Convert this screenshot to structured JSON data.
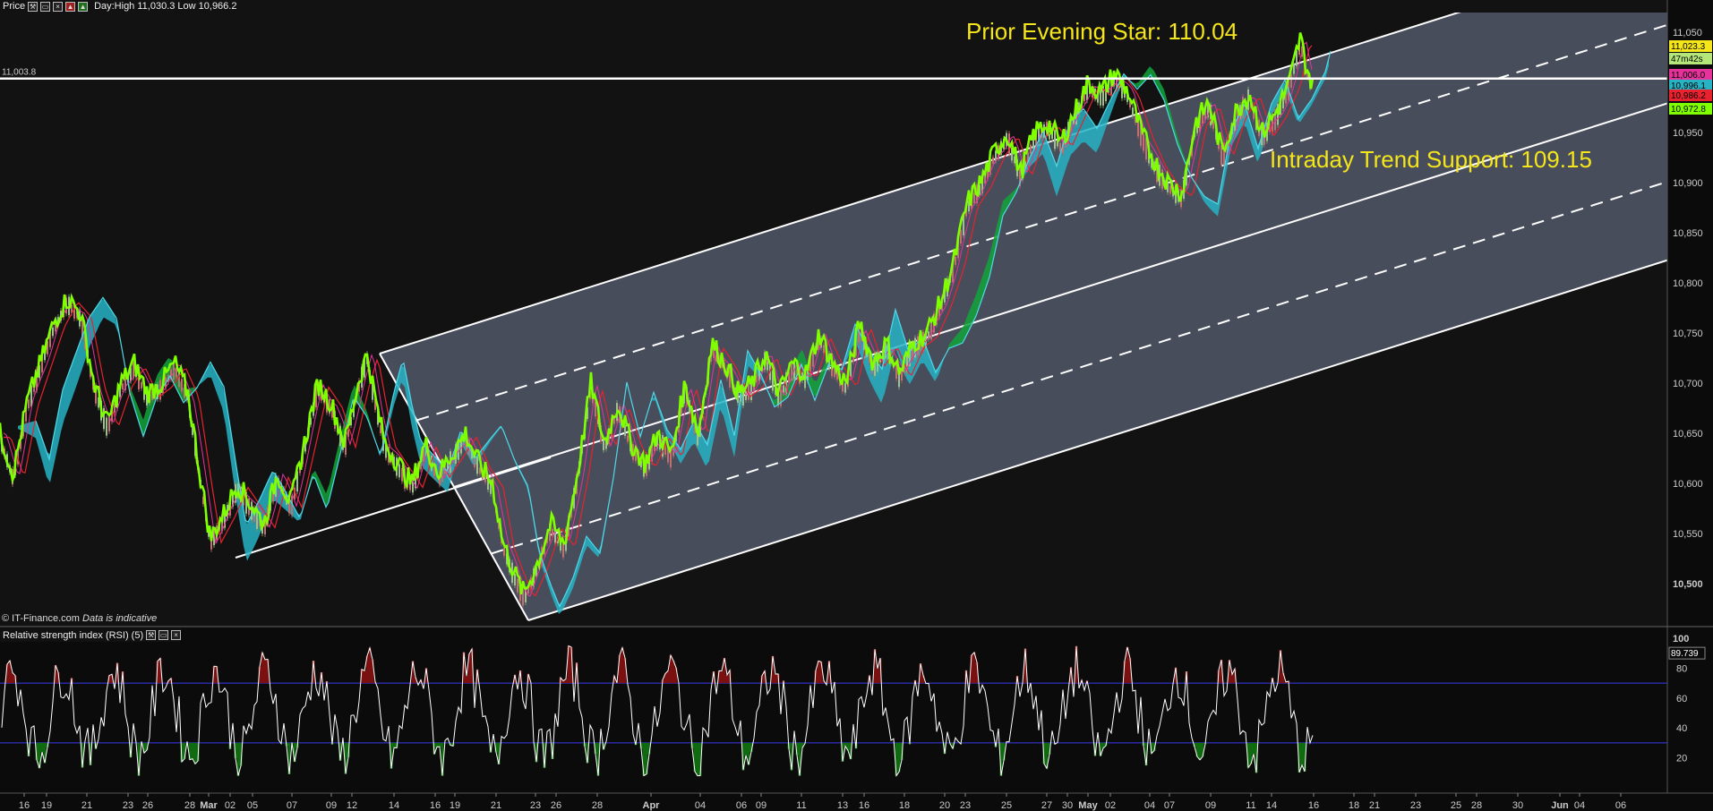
{
  "toolbar": {
    "title": "Price",
    "day_range": "Day:High 11,030.3 Low 10,966.2",
    "icons": [
      "wrench-icon",
      "window-icon",
      "close-icon",
      "chart-icon",
      "chart-add-icon"
    ]
  },
  "copyright": {
    "source": "© IT-Finance.com",
    "note": "Data is indicative"
  },
  "rsi_toolbar": {
    "title": "Relative strength index (RSI) (5)",
    "icons": [
      "wrench-icon",
      "window-icon",
      "close-icon"
    ]
  },
  "colors": {
    "background": "#0b0b0b",
    "channel_fill": "#5b6175",
    "price_line": "#7fff00",
    "cloud_bull": "#27b3c4",
    "cloud_bear": "#13a33a",
    "ma_red": "#e8222e",
    "annotation": "#f5e51b",
    "rsi_line": "#ffffff",
    "rsi_band": "#3a3af2"
  },
  "chart_data": [
    {
      "type": "line",
      "panel": "price",
      "y_ticks": [
        "11,050",
        "11,000",
        "10,950",
        "10,900",
        "10,850",
        "10,800",
        "10,750",
        "10,700",
        "10,650",
        "10,600",
        "10,550",
        "10,500"
      ],
      "ylim": [
        10480,
        11075
      ],
      "x_tick_labels": [
        "16",
        "19",
        "21",
        "23",
        "26",
        "28",
        "Mar",
        "02",
        "05",
        "07",
        "09",
        "12",
        "14",
        "16",
        "19",
        "21",
        "23",
        "26",
        "28",
        "Apr",
        "04",
        "06",
        "09",
        "11",
        "13",
        "16",
        "18",
        "20",
        "23",
        "25",
        "27",
        "30",
        "May",
        "02",
        "04",
        "07",
        "09",
        "11",
        "14",
        "16",
        "18",
        "21",
        "23",
        "25",
        "28",
        "30",
        "Jun",
        "04",
        "06"
      ],
      "x_tick_pos": [
        27,
        52,
        97,
        143,
        165,
        212,
        233,
        257,
        282,
        326,
        370,
        393,
        440,
        486,
        508,
        554,
        598,
        621,
        667,
        727,
        782,
        828,
        850,
        895,
        941,
        965,
        1010,
        1055,
        1078,
        1124,
        1169,
        1192,
        1215,
        1240,
        1284,
        1306,
        1352,
        1397,
        1420,
        1467,
        1512,
        1535,
        1581,
        1626,
        1649,
        1695,
        1742,
        1764,
        1810
      ],
      "horizontal_line": {
        "value": 11003.8,
        "label": "11,003.8"
      },
      "annotations": [
        {
          "text": "Prior Evening Star: 110.04",
          "anchor_value": 11043
        },
        {
          "text": "Intraday Trend Support: 109.15",
          "anchor_value": 10915
        }
      ],
      "right_labels": [
        {
          "text": "11,023.3",
          "value": 11023.3,
          "bg": "#f5e51b",
          "fg": "#000000"
        },
        {
          "text": "47m42s",
          "value": 11011,
          "bg": "#b4e67a",
          "fg": "#000000"
        },
        {
          "text": "11,006.0",
          "value": 11006.0,
          "bg": "#e6329b",
          "fg": "#000000"
        },
        {
          "text": "10,996.1",
          "value": 10996.1,
          "bg": "#27b3c4",
          "fg": "#000000"
        },
        {
          "text": "10,986.2",
          "value": 10986.2,
          "bg": "#e8222e",
          "fg": "#000000"
        },
        {
          "text": "10,972.8",
          "value": 10972.8,
          "bg": "#7fff00",
          "fg": "#000000"
        }
      ],
      "price_series": [
        [
          0,
          10650
        ],
        [
          15,
          10610
        ],
        [
          30,
          10680
        ],
        [
          45,
          10720
        ],
        [
          60,
          10760
        ],
        [
          75,
          10785
        ],
        [
          90,
          10770
        ],
        [
          105,
          10700
        ],
        [
          120,
          10660
        ],
        [
          135,
          10700
        ],
        [
          150,
          10720
        ],
        [
          165,
          10690
        ],
        [
          180,
          10700
        ],
        [
          195,
          10720
        ],
        [
          210,
          10690
        ],
        [
          225,
          10600
        ],
        [
          235,
          10545
        ],
        [
          250,
          10570
        ],
        [
          265,
          10600
        ],
        [
          280,
          10580
        ],
        [
          295,
          10560
        ],
        [
          310,
          10610
        ],
        [
          325,
          10580
        ],
        [
          340,
          10640
        ],
        [
          355,
          10700
        ],
        [
          370,
          10680
        ],
        [
          385,
          10640
        ],
        [
          400,
          10700
        ],
        [
          410,
          10730
        ],
        [
          420,
          10680
        ],
        [
          430,
          10640
        ],
        [
          445,
          10620
        ],
        [
          460,
          10600
        ],
        [
          475,
          10640
        ],
        [
          490,
          10610
        ],
        [
          505,
          10630
        ],
        [
          520,
          10650
        ],
        [
          535,
          10620
        ],
        [
          550,
          10600
        ],
        [
          562,
          10540
        ],
        [
          575,
          10510
        ],
        [
          585,
          10490
        ],
        [
          600,
          10520
        ],
        [
          615,
          10560
        ],
        [
          630,
          10540
        ],
        [
          645,
          10610
        ],
        [
          660,
          10700
        ],
        [
          675,
          10640
        ],
        [
          690,
          10680
        ],
        [
          705,
          10640
        ],
        [
          720,
          10620
        ],
        [
          735,
          10650
        ],
        [
          750,
          10630
        ],
        [
          765,
          10700
        ],
        [
          780,
          10650
        ],
        [
          795,
          10740
        ],
        [
          810,
          10720
        ],
        [
          825,
          10690
        ],
        [
          840,
          10700
        ],
        [
          855,
          10730
        ],
        [
          870,
          10690
        ],
        [
          885,
          10720
        ],
        [
          900,
          10710
        ],
        [
          915,
          10750
        ],
        [
          930,
          10720
        ],
        [
          945,
          10700
        ],
        [
          960,
          10760
        ],
        [
          975,
          10720
        ],
        [
          990,
          10740
        ],
        [
          1005,
          10710
        ],
        [
          1020,
          10740
        ],
        [
          1035,
          10750
        ],
        [
          1050,
          10780
        ],
        [
          1065,
          10820
        ],
        [
          1080,
          10880
        ],
        [
          1095,
          10900
        ],
        [
          1110,
          10930
        ],
        [
          1125,
          10950
        ],
        [
          1140,
          10910
        ],
        [
          1155,
          10950
        ],
        [
          1170,
          10960
        ],
        [
          1185,
          10940
        ],
        [
          1200,
          10970
        ],
        [
          1215,
          11000
        ],
        [
          1230,
          10990
        ],
        [
          1245,
          11010
        ],
        [
          1260,
          10990
        ],
        [
          1275,
          10950
        ],
        [
          1290,
          10920
        ],
        [
          1305,
          10900
        ],
        [
          1320,
          10890
        ],
        [
          1335,
          10960
        ],
        [
          1350,
          10980
        ],
        [
          1365,
          10930
        ],
        [
          1380,
          10970
        ],
        [
          1395,
          10990
        ],
        [
          1410,
          10950
        ],
        [
          1425,
          10970
        ],
        [
          1440,
          11000
        ],
        [
          1452,
          11045
        ],
        [
          1458,
          11020
        ],
        [
          1466,
          10995
        ]
      ],
      "rsi_panel": {
        "y_ticks": [
          "100",
          "80",
          "60",
          "40",
          "20"
        ],
        "ylim": [
          0,
          100
        ],
        "bands": [
          70,
          30
        ],
        "last_value": "89.739"
      }
    }
  ]
}
